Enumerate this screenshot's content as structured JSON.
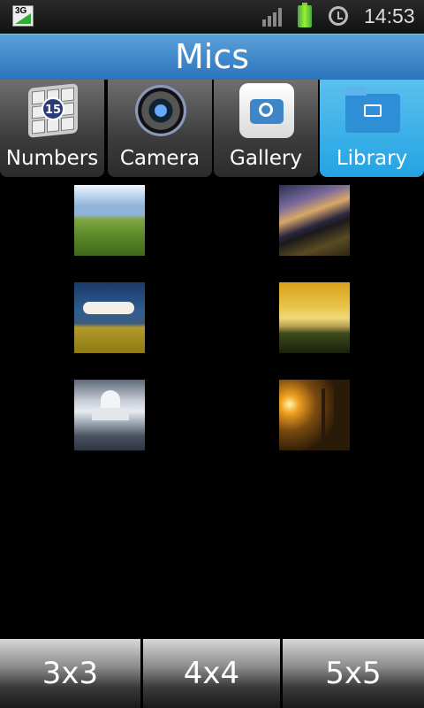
{
  "status_bar": {
    "network_label": "3G",
    "time": "14:53"
  },
  "title": "Mics",
  "tabs": [
    {
      "label": "Numbers",
      "icon": "numbers-cube-icon",
      "badge": "15",
      "active": false
    },
    {
      "label": "Camera",
      "icon": "camera-lens-icon",
      "active": false
    },
    {
      "label": "Gallery",
      "icon": "gallery-camera-icon",
      "active": false
    },
    {
      "label": "Library",
      "icon": "library-folder-icon",
      "active": true
    }
  ],
  "thumbnails": [
    {
      "name": "green-field-sky"
    },
    {
      "name": "stormy-sky-house"
    },
    {
      "name": "cloud-over-sunflowers"
    },
    {
      "name": "golden-lake-sunset"
    },
    {
      "name": "taj-mahal"
    },
    {
      "name": "sunlit-forest"
    }
  ],
  "grid_buttons": [
    {
      "label": "3x3"
    },
    {
      "label": "4x4"
    },
    {
      "label": "5x5"
    }
  ],
  "colors": {
    "titlebar": "#3a86cb",
    "active_tab": "#2aa7e6",
    "background": "#000000"
  }
}
